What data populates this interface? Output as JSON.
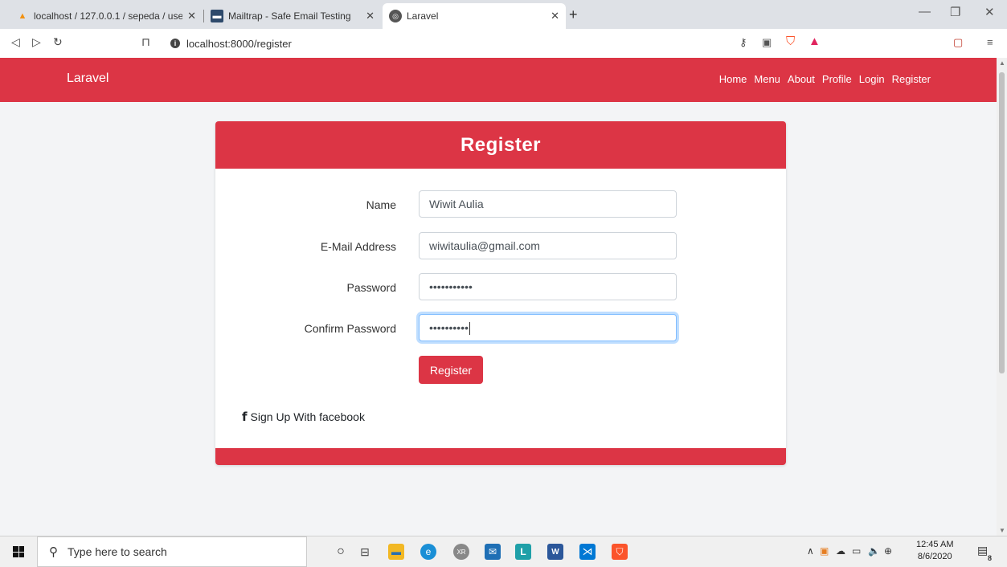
{
  "browser": {
    "tabs": [
      {
        "title": "localhost / 127.0.0.1 / sepeda / use",
        "icon": "phpmyadmin-icon",
        "active": false
      },
      {
        "title": "Mailtrap - Safe Email Testing",
        "icon": "mailtrap-icon",
        "active": false
      },
      {
        "title": "Laravel",
        "icon": "globe-icon",
        "active": true
      }
    ],
    "url": "localhost:8000/register"
  },
  "navbar": {
    "brand": "Laravel",
    "links": [
      "Home",
      "Menu",
      "About",
      "Profile",
      "Login",
      "Register"
    ],
    "color": "#dc3545"
  },
  "form": {
    "title": "Register",
    "fields": [
      {
        "label": "Name",
        "value": "Wiwit Aulia"
      },
      {
        "label": "E-Mail Address",
        "value": "wiwitaulia@gmail.com"
      },
      {
        "label": "Password",
        "value": "•••••••••••"
      },
      {
        "label": "Confirm Password",
        "value": "••••••••••"
      }
    ],
    "submit_label": "Register",
    "facebook_label": "Sign Up With facebook"
  },
  "taskbar": {
    "search_placeholder": "Type here to search",
    "time": "12:45 AM",
    "date": "8/6/2020",
    "notification_count": "8"
  }
}
